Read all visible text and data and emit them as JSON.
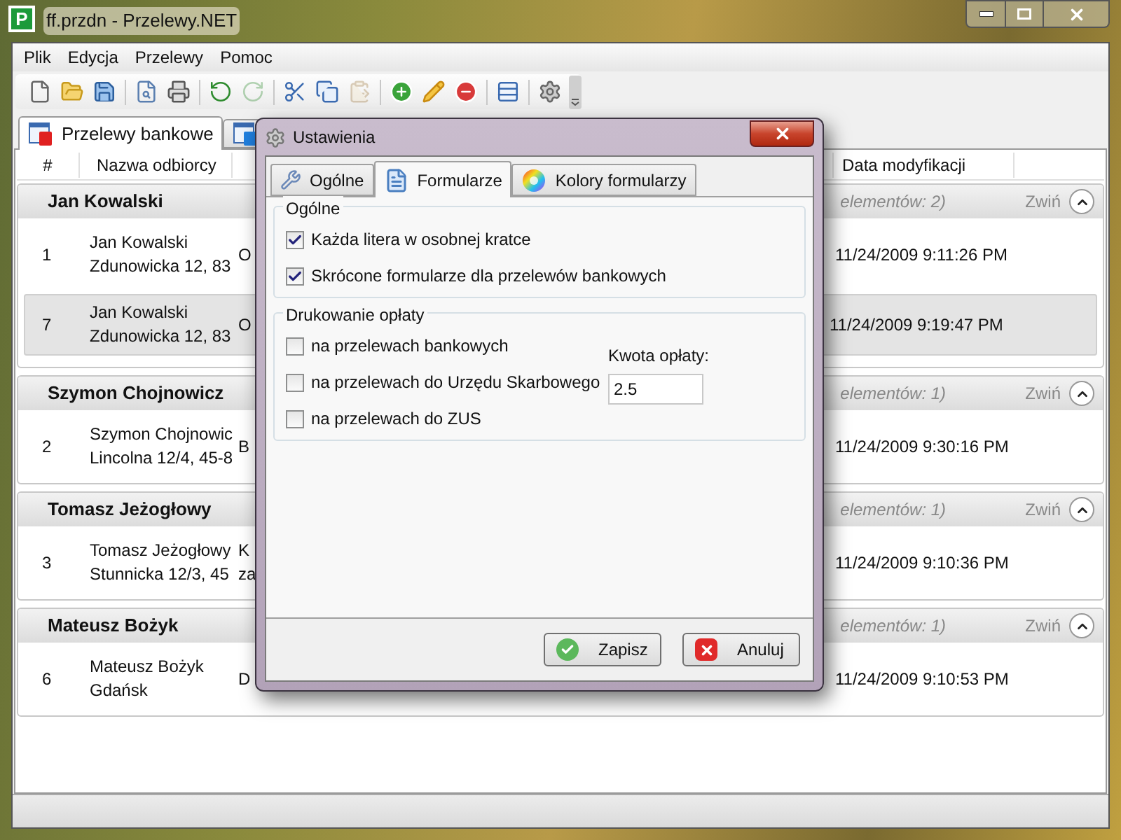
{
  "window": {
    "title": "ff.przdn - Przelewy.NET",
    "icon_letter": "P"
  },
  "menu": [
    "Plik",
    "Edycja",
    "Przelewy",
    "Pomoc"
  ],
  "toolbar": [
    {
      "kind": "new",
      "disabled": false
    },
    {
      "kind": "open",
      "disabled": false
    },
    {
      "kind": "save",
      "disabled": false
    },
    {
      "kind": "separator"
    },
    {
      "kind": "preview",
      "disabled": false
    },
    {
      "kind": "print",
      "disabled": false
    },
    {
      "kind": "separator"
    },
    {
      "kind": "undo",
      "disabled": false
    },
    {
      "kind": "redo",
      "disabled": true
    },
    {
      "kind": "separator"
    },
    {
      "kind": "cut",
      "disabled": false
    },
    {
      "kind": "copy",
      "disabled": false
    },
    {
      "kind": "paste",
      "disabled": true
    },
    {
      "kind": "separator"
    },
    {
      "kind": "add",
      "disabled": false
    },
    {
      "kind": "edit",
      "disabled": false
    },
    {
      "kind": "delete",
      "disabled": false
    },
    {
      "kind": "separator"
    },
    {
      "kind": "table",
      "disabled": false
    },
    {
      "kind": "separator"
    },
    {
      "kind": "settings",
      "disabled": false
    }
  ],
  "tabs": [
    {
      "label": "Przelewy bankowe",
      "selected": true,
      "kind": "bank"
    },
    {
      "selected": false,
      "kind": "other"
    }
  ],
  "columns": [
    "#",
    "Nazwa odbiorcy",
    "Data modyfikacji"
  ],
  "groups": [
    {
      "name": "Jan Kowalski",
      "count": "elementów: 2)",
      "collapse": "Zwiń",
      "rows": [
        {
          "number": "1",
          "name": "Jan Kowalski",
          "address": "Zdunowicka 12, 83",
          "column_3": [
            "O"
          ],
          "date": "11/24/2009 9:11:26 PM",
          "selected": false
        },
        {
          "number": "7",
          "name": "Jan Kowalski",
          "address": "Zdunowicka 12, 83",
          "column_3": [
            "O"
          ],
          "date": "11/24/2009 9:19:47 PM",
          "selected": true
        }
      ]
    },
    {
      "name": "Szymon Chojnowicz",
      "count": "elementów: 1)",
      "collapse": "Zwiń",
      "rows": [
        {
          "number": "2",
          "name": "Szymon Chojnowic",
          "address": "Lincolna 12/4, 45-8",
          "column_3": [
            "B"
          ],
          "date": "11/24/2009 9:30:16 PM",
          "selected": false
        }
      ]
    },
    {
      "name": "Tomasz Jeżogłowy",
      "count": "elementów: 1)",
      "collapse": "Zwiń",
      "rows": [
        {
          "number": "3",
          "name": "Tomasz Jeżogłowy",
          "address": "Stunnicka 12/3, 45",
          "column_3": [
            "K",
            "za"
          ],
          "date": "11/24/2009 9:10:36 PM",
          "selected": false
        }
      ]
    },
    {
      "name": "Mateusz Bożyk",
      "count": "elementów: 1)",
      "collapse": "Zwiń",
      "rows": [
        {
          "number": "6",
          "name": "Mateusz Bożyk",
          "address": "Gdańsk",
          "column_3": [
            "D"
          ],
          "date": "11/24/2009 9:10:53 PM",
          "selected": false
        }
      ]
    }
  ],
  "dialog": {
    "title": "Ustawienia",
    "tabs": [
      {
        "label": "Ogólne",
        "kind": "wrench",
        "selected": false
      },
      {
        "label": "Formularze",
        "kind": "document",
        "selected": true
      },
      {
        "label": "Kolory formularzy",
        "kind": "colors",
        "selected": false
      }
    ],
    "sections": [
      {
        "title": "Ogólne",
        "options": [
          {
            "label": "Każda litera w osobnej kratce",
            "checked": true
          },
          {
            "label": "Skrócone formularze dla przelewów bankowych",
            "checked": true
          }
        ]
      },
      {
        "title": "Drukowanie opłaty",
        "options": [
          {
            "label": "na przelewach bankowych",
            "checked": false
          },
          {
            "label": "na przelewach do Urzędu Skarbowego",
            "checked": false
          },
          {
            "label": "na przelewach do ZUS",
            "checked": false
          }
        ],
        "fee": {
          "label": "Kwota opłaty:",
          "value": "2.5"
        }
      }
    ],
    "buttons": [
      {
        "label": "Zapisz",
        "kind": "ok"
      },
      {
        "label": "Anuluj",
        "kind": "cancel"
      }
    ]
  }
}
